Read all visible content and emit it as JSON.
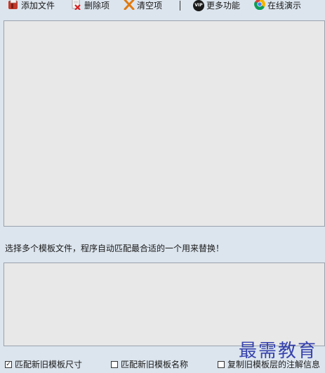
{
  "toolbar": {
    "add_file": "添加文件",
    "delete_item": "删除项",
    "clear_items": "清空项",
    "vip_badge": "VIP",
    "more_features": "更多功能",
    "online_demo": "在线演示"
  },
  "hint": "选择多个模板文件，程序自动匹配最合适的一个用来替换！",
  "options": [
    {
      "label": "匹配新旧模板尺寸",
      "checked": true
    },
    {
      "label": "匹配新旧模板名称",
      "checked": false
    },
    {
      "label": "复制旧模板层的注解信息",
      "checked": false
    }
  ],
  "watermark": "最需教育",
  "colors": {
    "background": "#dce5ee",
    "panel": "#e8e8e8",
    "clear_icon": "#e07a10",
    "watermark": "#2a36a8"
  }
}
